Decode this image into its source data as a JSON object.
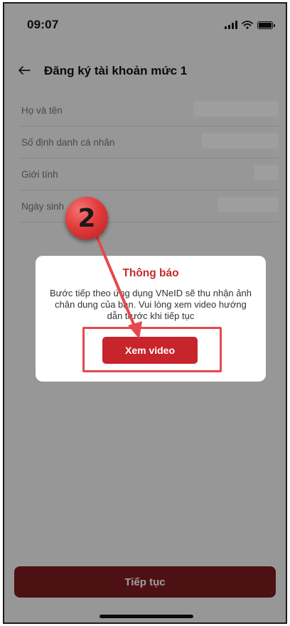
{
  "status_bar": {
    "time": "09:07",
    "icons": [
      "cellular-signal-icon",
      "wifi-icon",
      "battery-icon"
    ]
  },
  "header": {
    "back_icon": "arrow-left-icon",
    "title": "Đăng ký tài khoản mức 1"
  },
  "form": {
    "rows": [
      {
        "label": "Họ và tên"
      },
      {
        "label": "Số định danh cá nhân"
      },
      {
        "label": "Giới tính"
      },
      {
        "label": "Ngày sinh"
      }
    ]
  },
  "dialog": {
    "title": "Thông báo",
    "message": "Bước tiếp theo ứng dụng VNeID sẽ thu nhận ảnh chân dung của bạn. Vui lòng xem video hướng dẫn trước khi tiếp tục",
    "primary_button": "Xem video"
  },
  "footer": {
    "continue_button": "Tiếp tục"
  },
  "annotation": {
    "step_number": "2"
  },
  "colors": {
    "accent_red": "#c8242b",
    "dialog_title": "#c62a2a",
    "annotation_red": "#e23c3c",
    "disabled_button": "#7e1c1f"
  }
}
